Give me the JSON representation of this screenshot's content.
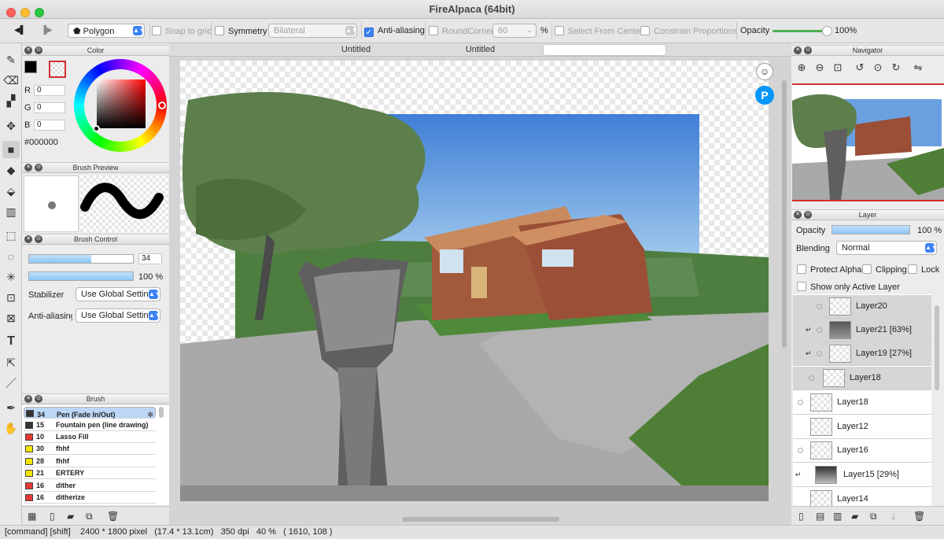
{
  "window": {
    "title": "FireAlpaca (64bit)"
  },
  "toolbar": {
    "tool_select": "Polygon",
    "snap_to_grid": "Snap to grid",
    "symmetry": "Symmetry",
    "symmetry_mode": "Bilateral",
    "anti_aliasing": "Anti-aliasing",
    "round_corner": "RoundCorner",
    "round_corner_value": "60",
    "percent": "%",
    "select_from_center": "Select From Center",
    "constrain_proportions": "Constrain Proportions",
    "opacity_label": "Opacity",
    "opacity_value": "100%",
    "opacity_level": 1.0
  },
  "color_panel": {
    "title": "Color",
    "r_label": "R",
    "r_value": "0",
    "g_label": "G",
    "g_value": "0",
    "b_label": "B",
    "b_value": "0",
    "hex": "#000000"
  },
  "brush_preview": {
    "title": "Brush Preview"
  },
  "brush_control": {
    "title": "Brush Control",
    "size_value": "34",
    "size_level": 0.6,
    "opacity_value": "100 %",
    "opacity_level": 1.0,
    "stabilizer_label": "Stabilizer",
    "stabilizer_value": "Use Global Setting",
    "anti_aliasing_label": "Anti-aliasing",
    "anti_aliasing_value": "Use Global Setting"
  },
  "brush_list": {
    "title": "Brush",
    "items": [
      {
        "num": "34",
        "name": "Pen (Fade In/Out)",
        "color": "#333333"
      },
      {
        "num": "15",
        "name": "Fountain pen (line drawing)",
        "color": "#333333"
      },
      {
        "num": "10",
        "name": "Lasso Fill",
        "color": "#e53935"
      },
      {
        "num": "30",
        "name": "fhhf",
        "color": "#f4e600"
      },
      {
        "num": "28",
        "name": "fhhf",
        "color": "#f4e600"
      },
      {
        "num": "21",
        "name": "ERTERY",
        "color": "#f4e600"
      },
      {
        "num": "16",
        "name": "dither",
        "color": "#e53935"
      },
      {
        "num": "16",
        "name": "ditherize",
        "color": "#e53935"
      }
    ]
  },
  "tabs": [
    "Untitled",
    "Untitled",
    ""
  ],
  "navigator": {
    "title": "Navigator"
  },
  "layer_panel": {
    "title": "Layer",
    "opacity_label": "Opacity",
    "opacity_value": "100 %",
    "opacity_level": 1.0,
    "blending_label": "Blending",
    "blending_value": "Normal",
    "protect_alpha": "Protect Alpha",
    "clipping": "Clipping",
    "lock": "Lock",
    "show_only_active": "Show only Active Layer",
    "layers": [
      "Layer20",
      "Layer21 [63%]",
      "Layer19 [27%]",
      "Layer18",
      "Layer18",
      "Layer12",
      "Layer16",
      "Layer15 [29%]",
      "Layer14"
    ]
  },
  "status": {
    "keys": "[command] [shift]",
    "size": "2400 * 1800 pixel",
    "physical": "(17.4 * 13.1cm)",
    "dpi": "350 dpi",
    "zoom": "40 %",
    "coords": "( 1610, 108 )"
  }
}
